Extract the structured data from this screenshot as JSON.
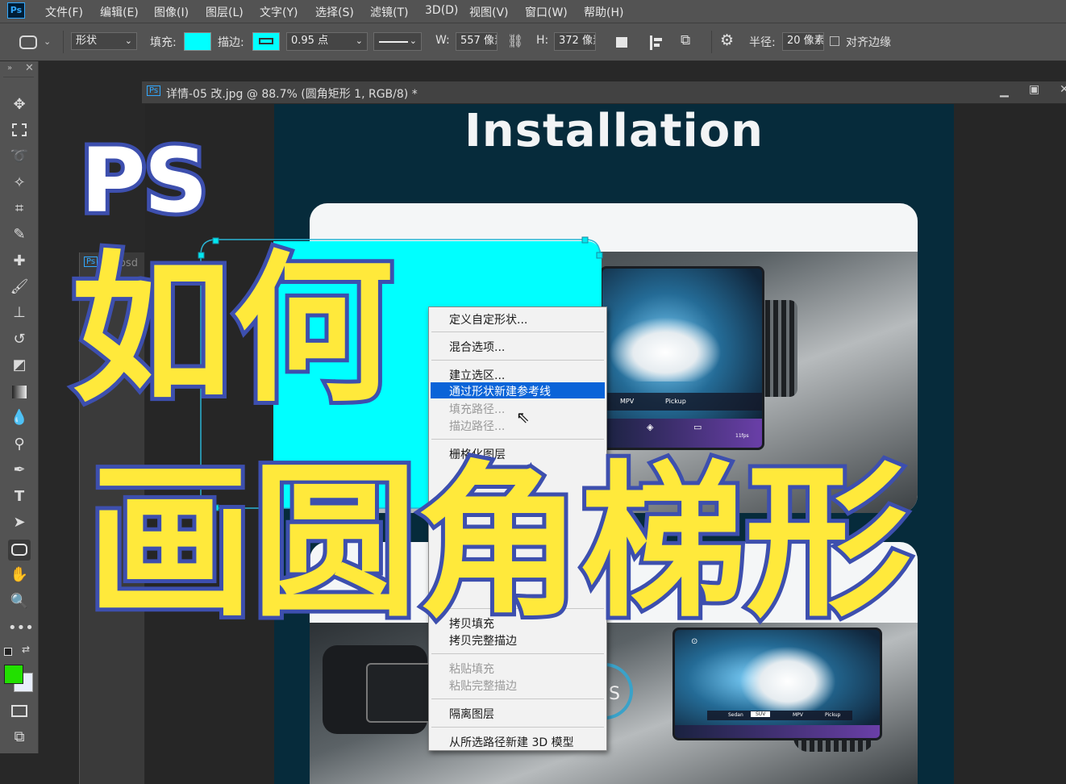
{
  "menubar": {
    "logo": "Ps",
    "items": [
      "文件(F)",
      "编辑(E)",
      "图像(I)",
      "图层(L)",
      "文字(Y)",
      "选择(S)",
      "滤镜(T)",
      "3D(D)",
      "视图(V)",
      "窗口(W)",
      "帮助(H)"
    ]
  },
  "options": {
    "mode": "形状",
    "fill_label": "填充:",
    "stroke_label": "描边:",
    "stroke_width": "0.95 点",
    "w_label": "W:",
    "w_value": "557 像素",
    "h_label": "H:",
    "h_value": "372 像素",
    "radius_label": "半径:",
    "radius_value": "20 像素",
    "align_edges": "对齐边缘",
    "fill_color": "#00ffff"
  },
  "document": {
    "title": "详情-05 改.jpg @ 88.7% (圆角矩形 1, RGB/8) *",
    "background_tab": "11.psd",
    "heading": "Installation"
  },
  "screen_top": {
    "tabs": [
      "MPV",
      "Pickup"
    ],
    "fps": "11fps"
  },
  "screen_bottom": {
    "tabs": [
      "Sedan",
      "SUV",
      "MPV",
      "Pickup"
    ]
  },
  "context_menu": {
    "items": [
      {
        "label": "定义自定形状...",
        "state": "normal"
      },
      {
        "label": "混合选项...",
        "state": "normal"
      },
      {
        "label": "建立选区...",
        "state": "normal"
      },
      {
        "label": "通过形状新建参考线",
        "state": "highlighted"
      },
      {
        "label": "填充路径...",
        "state": "disabled"
      },
      {
        "label": "描边路径...",
        "state": "disabled"
      },
      {
        "label": "栅格化图层",
        "state": "normal"
      },
      {
        "label": "拷贝填充",
        "state": "normal"
      },
      {
        "label": "拷贝完整描边",
        "state": "normal"
      },
      {
        "label": "粘贴填充",
        "state": "disabled"
      },
      {
        "label": "粘贴完整描边",
        "state": "disabled"
      },
      {
        "label": "隔离图层",
        "state": "normal"
      },
      {
        "label": "从所选路径新建 3D 模型",
        "state": "normal"
      }
    ]
  },
  "overlay": {
    "line1": "PS",
    "line2": "如何",
    "line3": "画圆角梯形"
  },
  "colors": {
    "foreground": "#22e000",
    "background": "#ffffff",
    "highlight": "#0a64d8",
    "overlay_fill": "#ffe93b",
    "overlay_stroke": "#3d4fae"
  }
}
